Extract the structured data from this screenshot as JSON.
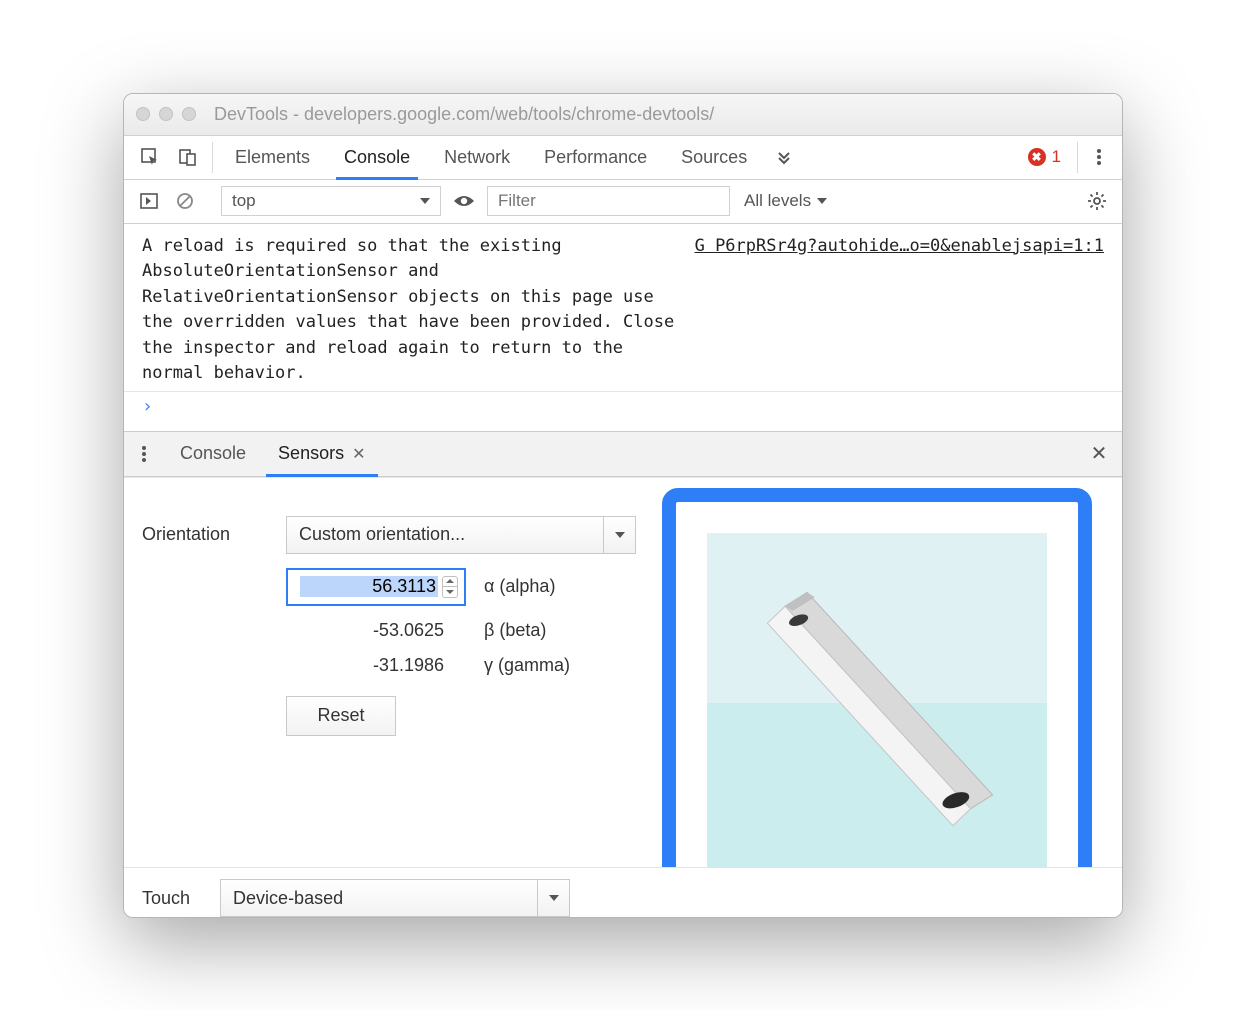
{
  "window": {
    "title": "DevTools - developers.google.com/web/tools/chrome-devtools/"
  },
  "mainTabs": {
    "elements": "Elements",
    "console": "Console",
    "network": "Network",
    "performance": "Performance",
    "sources": "Sources"
  },
  "errors": {
    "glyph": "✖",
    "count": "1"
  },
  "consoleToolbar": {
    "context": "top",
    "filterPlaceholder": "Filter",
    "levels": "All levels"
  },
  "consoleMessage": {
    "text": "A reload is required so that the existing AbsoluteOrientationSensor and RelativeOrientationSensor objects on this page use the overridden values that have been provided. Close the inspector and reload again to return to the normal behavior.",
    "source": "G P6rpRSr4g?autohide…o=0&enablejsapi=1:1",
    "prompt": "›"
  },
  "drawer": {
    "consoleTab": "Console",
    "sensorsTab": "Sensors"
  },
  "sensors": {
    "orientationLabel": "Orientation",
    "orientationSelect": "Custom orientation...",
    "alphaValue": "56.3113",
    "alphaLabel": "α (alpha)",
    "betaValue": "-53.0625",
    "betaLabel": "β (beta)",
    "gammaValue": "-31.1986",
    "gammaLabel": "γ (gamma)",
    "reset": "Reset",
    "touchLabel": "Touch",
    "touchSelect": "Device-based"
  }
}
